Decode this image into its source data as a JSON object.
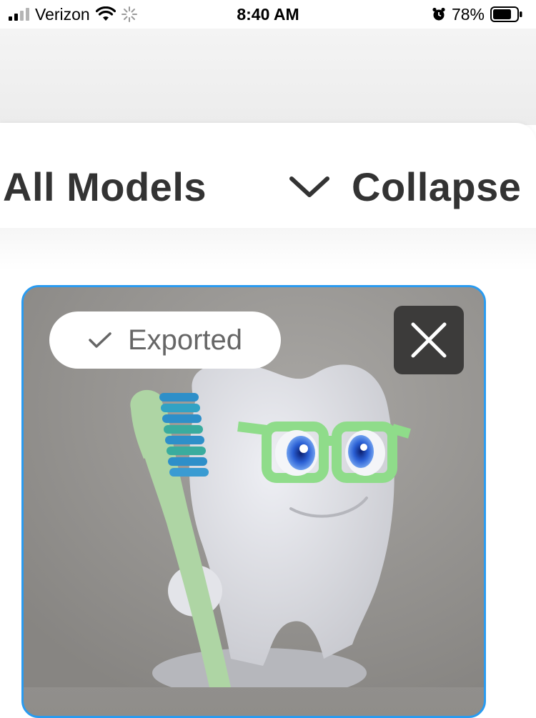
{
  "status_bar": {
    "carrier": "Verizon",
    "time": "8:40 AM",
    "battery": "78%",
    "battery_level": 0.78
  },
  "header": {
    "title": "All Models",
    "collapse_label": "Collapse"
  },
  "model_card": {
    "badge_label": "Exported",
    "accent_color": "#2a9bf0",
    "icons": [
      "check-icon",
      "close-icon"
    ]
  }
}
